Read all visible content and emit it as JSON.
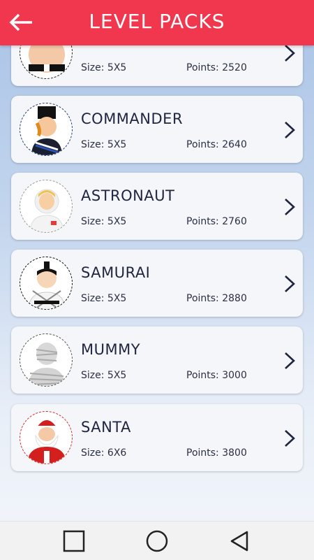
{
  "header": {
    "title": "LEVEL PACKS",
    "back_icon": "arrow-left-icon"
  },
  "packs": [
    {
      "name": "",
      "size": "Size: 5X5",
      "points": "Points: 2520"
    },
    {
      "name": "COMMANDER",
      "size": "Size: 5X5",
      "points": "Points: 2640"
    },
    {
      "name": "ASTRONAUT",
      "size": "Size: 5X5",
      "points": "Points: 2760"
    },
    {
      "name": "SAMURAI",
      "size": "Size: 5X5",
      "points": "Points: 2880"
    },
    {
      "name": "MUMMY",
      "size": "Size: 5X5",
      "points": "Points: 3000"
    },
    {
      "name": "SANTA",
      "size": "Size: 6X6",
      "points": "Points: 3800"
    }
  ],
  "nav": {
    "recent_icon": "square-icon",
    "home_icon": "circle-icon",
    "back_icon": "triangle-back-icon"
  },
  "colors": {
    "accent": "#f0374d",
    "text": "#1f2540"
  }
}
